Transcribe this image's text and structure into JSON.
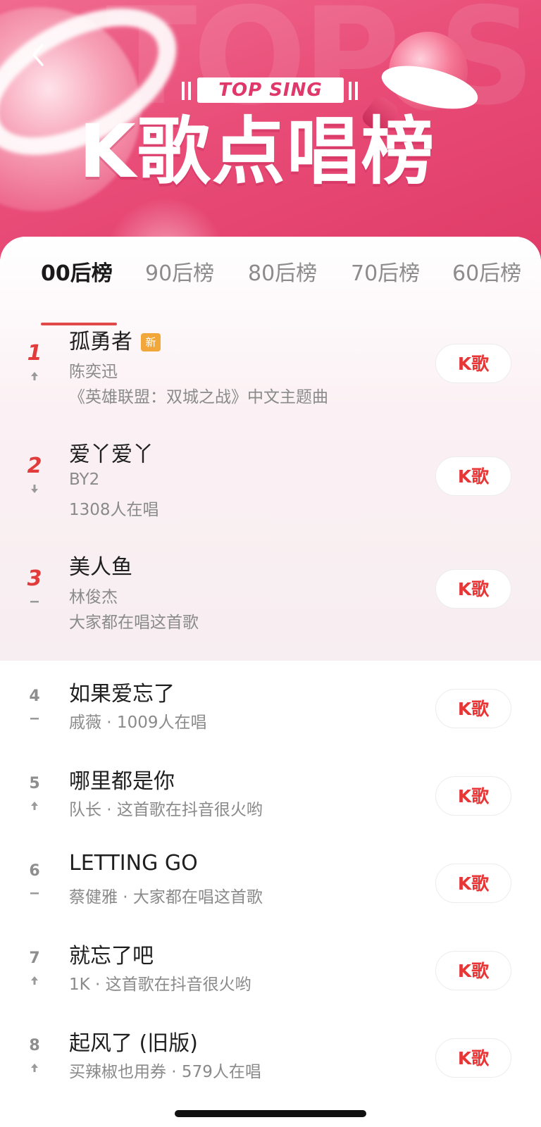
{
  "hero": {
    "badge": "TOP SING",
    "title": "K歌点唱榜",
    "watermark": "TOP SING",
    "colors": {
      "gradient_start": "#f06a8f",
      "gradient_end": "#e03a67"
    }
  },
  "back_icon": "chevron-left-icon",
  "tabs": [
    {
      "label": "00后榜",
      "active": true
    },
    {
      "label": "90后榜",
      "active": false
    },
    {
      "label": "80后榜",
      "active": false
    },
    {
      "label": "70后榜",
      "active": false
    },
    {
      "label": "60后榜",
      "active": false
    }
  ],
  "songs": [
    {
      "rank": "1",
      "trend": "up",
      "title": "孤勇者",
      "is_new": true,
      "new_label": "新",
      "artist": "陈奕迅",
      "note": "《英雄联盟：双城之战》中文主题曲",
      "button": "K歌"
    },
    {
      "rank": "2",
      "trend": "down",
      "title": "爱丫爱丫",
      "artist": "BY2",
      "note": "1308人在唱",
      "button": "K歌"
    },
    {
      "rank": "3",
      "trend": "flat",
      "title": "美人鱼",
      "artist": "林俊杰",
      "note": "大家都在唱这首歌",
      "button": "K歌"
    },
    {
      "rank": "4",
      "trend": "flat",
      "title": "如果爱忘了",
      "subtitle": "戚薇 · 1009人在唱",
      "button": "K歌"
    },
    {
      "rank": "5",
      "trend": "up",
      "title": "哪里都是你",
      "subtitle": "队长 · 这首歌在抖音很火哟",
      "button": "K歌"
    },
    {
      "rank": "6",
      "trend": "flat",
      "title": "LETTING GO",
      "subtitle": "蔡健雅 · 大家都在唱这首歌",
      "button": "K歌"
    },
    {
      "rank": "7",
      "trend": "up",
      "title": "就忘了吧",
      "subtitle": "1K · 这首歌在抖音很火哟",
      "button": "K歌"
    },
    {
      "rank": "8",
      "trend": "up",
      "title": "起风了 (旧版)",
      "subtitle": "买辣椒也用券 · 579人在唱",
      "button": "K歌"
    }
  ],
  "colors": {
    "accent": "#e83535",
    "rank_top": "#e23b3b",
    "new_tag": "#f1a739"
  }
}
